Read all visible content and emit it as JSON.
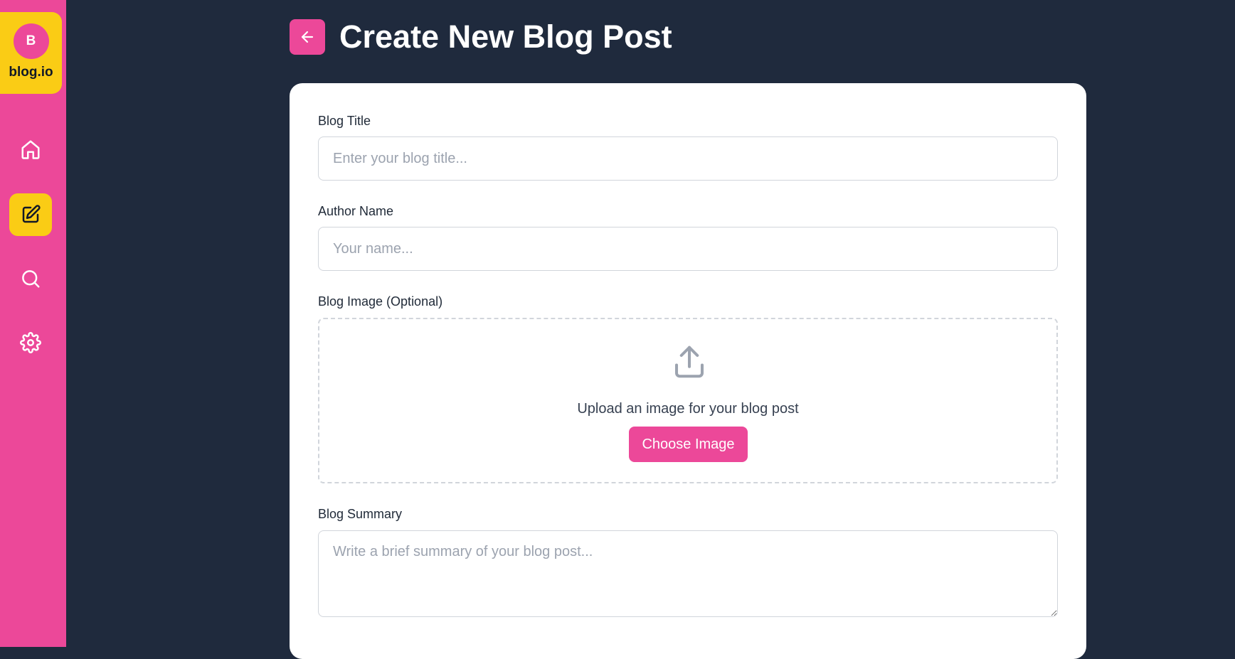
{
  "brand": {
    "initial": "B",
    "name": "blog.io",
    "accent_pink": "#ec4899",
    "accent_yellow": "#facc15",
    "background": "#1f2a3d"
  },
  "sidebar": {
    "items": [
      {
        "icon": "home-icon",
        "active": false
      },
      {
        "icon": "edit-icon",
        "active": true
      },
      {
        "icon": "search-icon",
        "active": false
      },
      {
        "icon": "gear-icon",
        "active": false
      }
    ]
  },
  "header": {
    "back_icon": "arrow-left-icon",
    "title": "Create New Blog Post"
  },
  "form": {
    "title": {
      "label": "Blog Title",
      "placeholder": "Enter your blog title...",
      "value": ""
    },
    "author": {
      "label": "Author Name",
      "placeholder": "Your name...",
      "value": ""
    },
    "image": {
      "label": "Blog Image (Optional)",
      "icon": "upload-icon",
      "prompt": "Upload an image for your blog post",
      "button_label": "Choose Image"
    },
    "summary": {
      "label": "Blog Summary",
      "placeholder": "Write a brief summary of your blog post...",
      "value": ""
    }
  }
}
